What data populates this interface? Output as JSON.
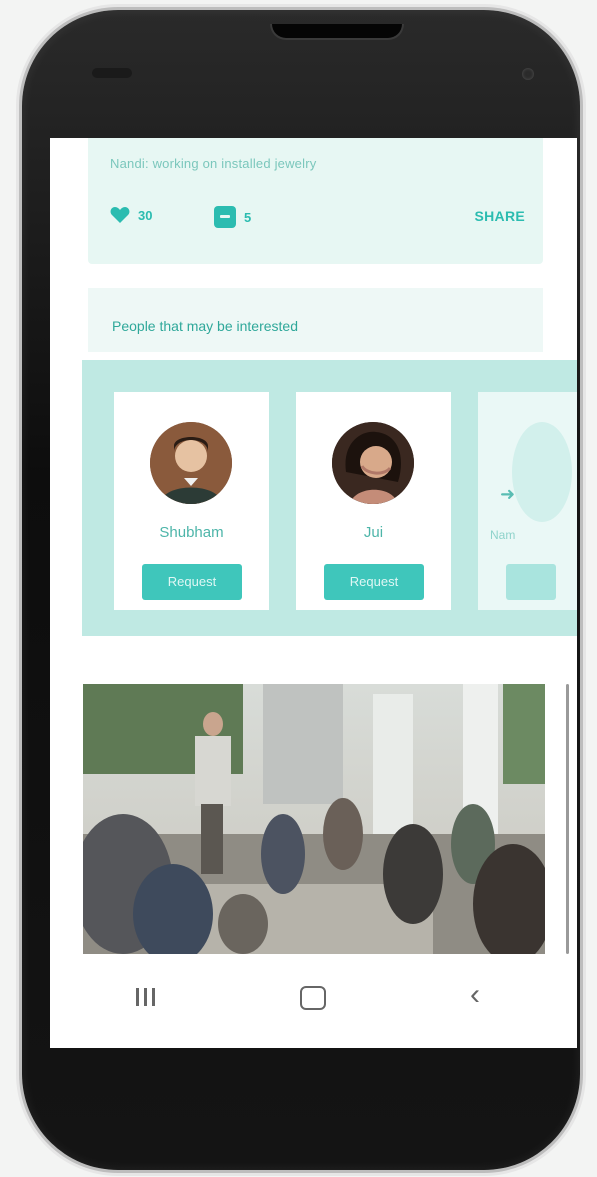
{
  "post": {
    "text": "Nandi: working on installed jewelry",
    "likes": "30",
    "comments": "5",
    "share_label": "SHARE"
  },
  "people": {
    "title": "People that may be interested",
    "cards": [
      {
        "name": "Shubham",
        "button": "Request"
      },
      {
        "name": "Jui",
        "button": "Request"
      }
    ],
    "next_label": "Nam"
  },
  "nav": {
    "recent_icon": "recent-apps-icon",
    "home_icon": "home-icon",
    "back_icon": "back-icon"
  },
  "colors": {
    "accent": "#2bbcb0",
    "button": "#3fc6bb",
    "card_bg": "#e7f7f3",
    "strip_bg": "#bfe9e3"
  }
}
